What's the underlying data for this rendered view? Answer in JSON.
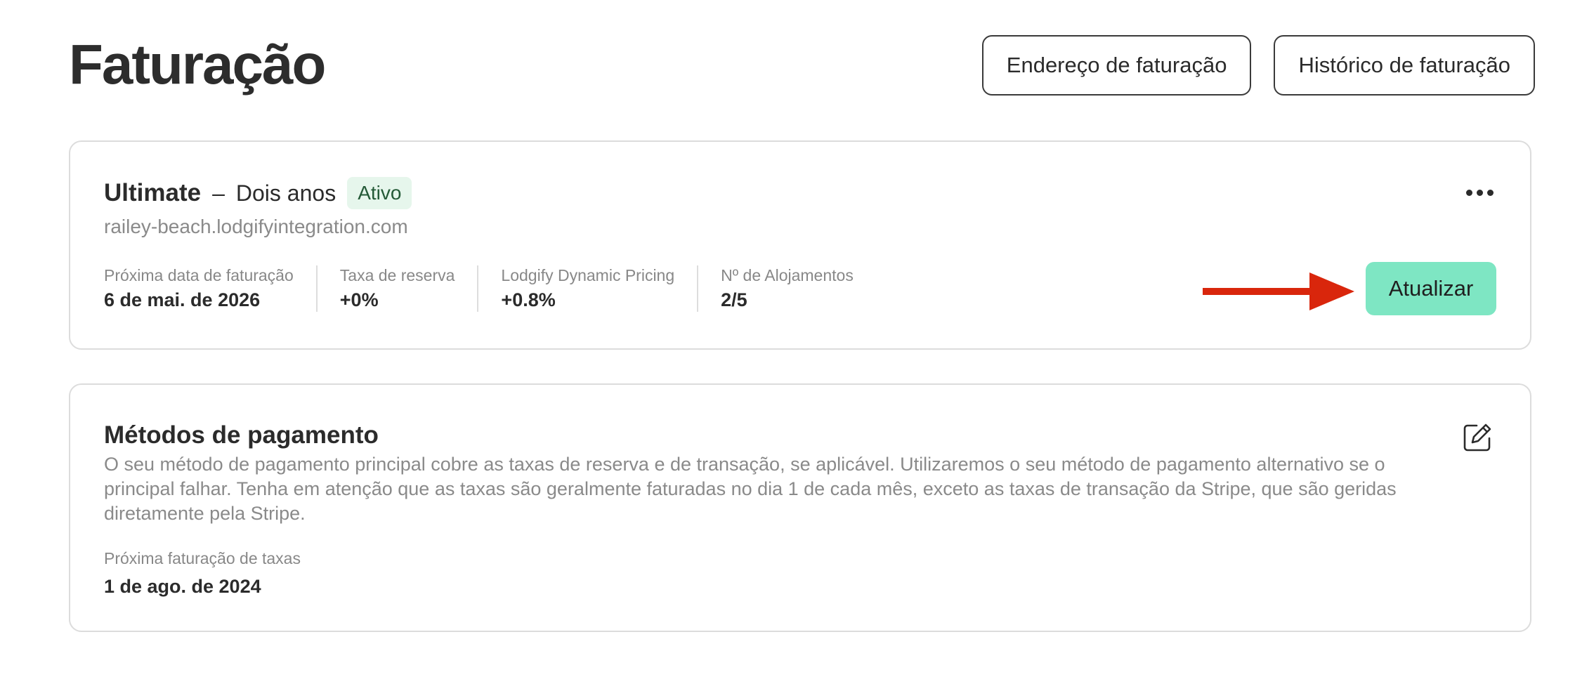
{
  "page": {
    "title": "Faturação"
  },
  "header": {
    "billing_address_label": "Endereço de faturação",
    "billing_history_label": "Histórico de faturação"
  },
  "plan": {
    "name": "Ultimate",
    "separator": "–",
    "period": "Dois anos",
    "status": "Ativo",
    "domain": "railey-beach.lodgifyintegration.com",
    "more_icon": "more-horizontal-icon",
    "stats": [
      {
        "label": "Próxima data de faturação",
        "value": "6 de mai. de 2026"
      },
      {
        "label": "Taxa de reserva",
        "value": "+0%"
      },
      {
        "label": "Lodgify Dynamic Pricing",
        "value": "+0.8%"
      },
      {
        "label": "Nº de Alojamentos",
        "value": "2/5"
      }
    ],
    "update_label": "Atualizar"
  },
  "payment": {
    "title": "Métodos de pagamento",
    "description": "O seu método de pagamento principal cobre as taxas de reserva e de transação, se aplicável. Utilizaremos o seu método de pagamento alternativo se o principal falhar. Tenha em atenção que as taxas são geralmente faturadas no dia 1 de cada mês, exceto as taxas de transação da Stripe, que são geridas diretamente pela Stripe.",
    "next_fee_label": "Próxima faturação de taxas",
    "next_fee_value": "1 de ago. de 2024",
    "edit_icon": "edit-icon"
  },
  "colors": {
    "accent_button": "#7ee6c3",
    "annotation_arrow": "#d9260c",
    "status_badge_bg": "#e6f6ec"
  }
}
